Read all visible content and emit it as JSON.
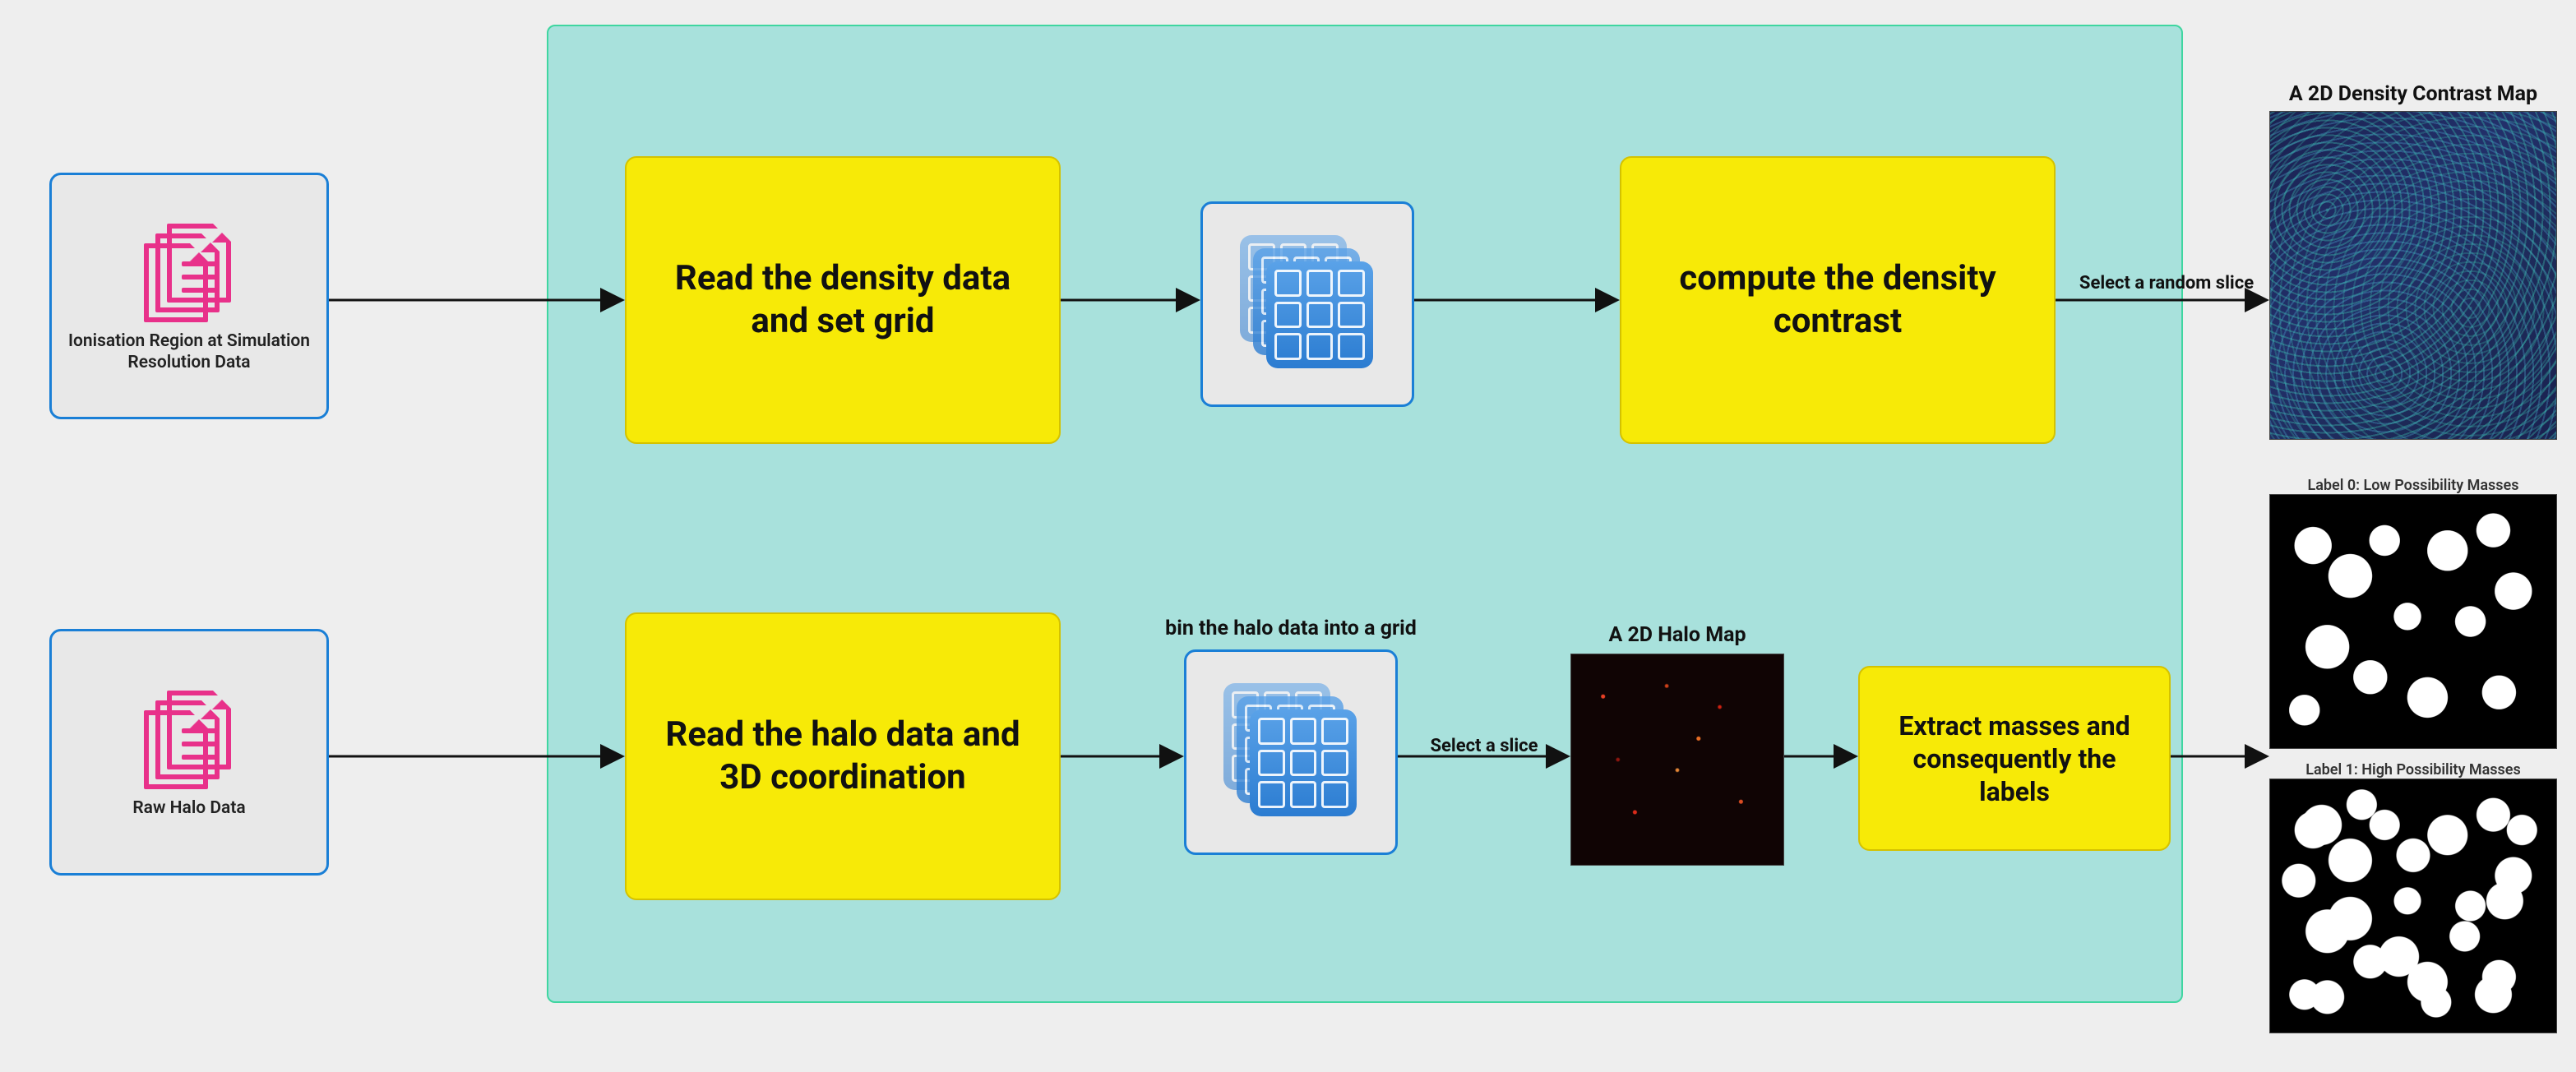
{
  "inputs": {
    "ionisation": {
      "caption": "Ionisation Region at Simulation Resolution Data"
    },
    "halo": {
      "caption": "Raw Halo Data"
    }
  },
  "processes": {
    "read_density": "Read the density data and set grid",
    "compute_contrast": "compute the density contrast",
    "read_halo": "Read the halo data and 3D coordination",
    "extract_masses": "Extract masses and consequently the labels"
  },
  "captions": {
    "bin_halo": "bin the halo data into a grid",
    "halo_map": "A 2D Halo Map",
    "density_map": "A 2D Density Contrast Map",
    "label0": "Label 0: Low Possibility Masses",
    "label1": "Label 1: High Possibility Masses"
  },
  "arrow_labels": {
    "select_random_slice": "Select a random slice",
    "select_slice": "Select a slice"
  }
}
